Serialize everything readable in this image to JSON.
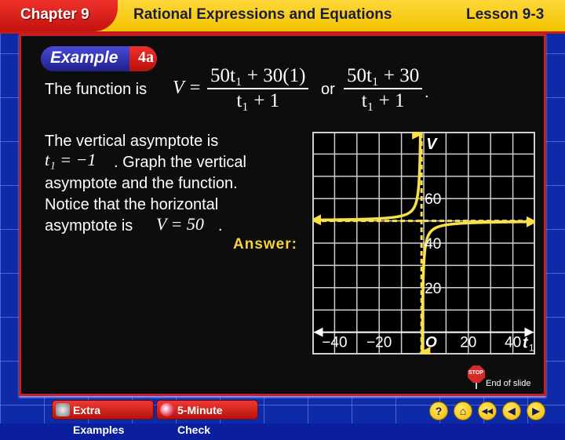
{
  "header": {
    "chapter": "Chapter 9",
    "title": "Rational Expressions and Equations",
    "lesson": "Lesson 9-3"
  },
  "example": {
    "word": "Example",
    "number": "4a"
  },
  "content": {
    "function_intro": "The function is",
    "function_lhs": "V =",
    "frac1_num": "50t₁ + 30(1)",
    "frac1_den": "t₁ + 1",
    "or_word": "or",
    "frac2_num": "50t₁ + 30",
    "frac2_den": "t₁ + 1",
    "period": ".",
    "para_line1": "The vertical asymptote is",
    "para_line2_math": "t₁ = −1",
    "para_line2_text": ". Graph the vertical",
    "para_line3": "asymptote and the function.",
    "para_line4": "Notice that the horizontal",
    "para_line5_text": "asymptote is",
    "para_line5_math": "V = 50",
    "para_line5_end": ".",
    "answer_label": "Answer:"
  },
  "chart_data": {
    "type": "line",
    "title": "",
    "function": "V = (50t1 + 30) / (t1 + 1)",
    "xlabel": "t1",
    "ylabel": "V",
    "origin_label": "O",
    "xlim": [
      -50,
      50
    ],
    "ylim": [
      -10,
      90
    ],
    "x_ticks": [
      -40,
      -20,
      20,
      40
    ],
    "x_tick_labels": [
      "−40",
      "−20",
      "20",
      "40"
    ],
    "y_ticks": [
      20,
      40,
      60
    ],
    "y_tick_labels": [
      "20",
      "40",
      "60"
    ],
    "grid": true,
    "grid_step": 10,
    "vertical_asymptote": -1,
    "horizontal_asymptote": 50,
    "series": [
      {
        "name": "left branch",
        "domain": [
          -50,
          -1.3
        ]
      },
      {
        "name": "right branch",
        "domain": [
          -0.98,
          50
        ]
      }
    ],
    "colors": {
      "curve": "#f7e04a",
      "grid": "#cfcfcf",
      "axis": "#ffffff"
    }
  },
  "end_of_slide": {
    "stop_text": "STOP",
    "label": "End of slide"
  },
  "footer": {
    "extra_examples": "Extra Examples",
    "five_minute_check": "5-Minute Check",
    "nav": [
      {
        "name": "help",
        "glyph": "?"
      },
      {
        "name": "home",
        "glyph": "⌂"
      },
      {
        "name": "first",
        "glyph": "◀◀"
      },
      {
        "name": "previous",
        "glyph": "◀"
      },
      {
        "name": "next",
        "glyph": "▶"
      }
    ]
  }
}
